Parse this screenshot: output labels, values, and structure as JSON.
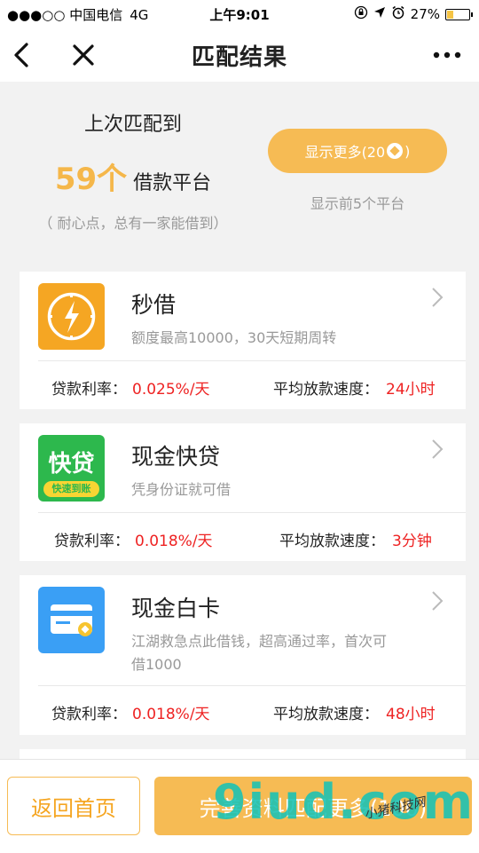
{
  "status": {
    "carrier": "●●●○○ 中国电信",
    "network": "4G",
    "time": "上午9:01",
    "battery": "27%"
  },
  "nav": {
    "title": "匹配结果"
  },
  "summary": {
    "last_match": "上次匹配到",
    "count": "59个",
    "count_suffix": "借款平台",
    "hint": "（ 耐心点，总有一家能借到）",
    "show_more": "显示更多(20",
    "show_more_end": ")",
    "first5": "显示前5个平台"
  },
  "platforms": [
    {
      "name": "秒借",
      "desc": "额度最高10000，30天短期周转",
      "rate_label": "贷款利率：",
      "rate": "0.025%/天",
      "speed_label": "平均放款速度：",
      "speed": "24小时",
      "logo_color": "#f5a623"
    },
    {
      "name": "现金快贷",
      "desc": "凭身份证就可借",
      "rate_label": "贷款利率：",
      "rate": "0.018%/天",
      "speed_label": "平均放款速度：",
      "speed": "3分钟",
      "logo_text": "快贷",
      "logo_sub": "快速到账",
      "logo_color": "#2db84d"
    },
    {
      "name": "现金白卡",
      "desc": "江湖救急点此借钱，超高通过率，首次可借1000",
      "rate_label": "贷款利率：",
      "rate": "0.018%/天",
      "speed_label": "平均放款速度：",
      "speed": "48小时",
      "logo_color": "#3a9ff5"
    }
  ],
  "bottom": {
    "home": "返回首页",
    "complete": "完善资料匹配更多(100)"
  },
  "watermark": {
    "main": "9iud.com",
    "sub": "小猪科技网"
  },
  "colors": {
    "accent": "#f6bb54",
    "highlight": "#e22222"
  }
}
